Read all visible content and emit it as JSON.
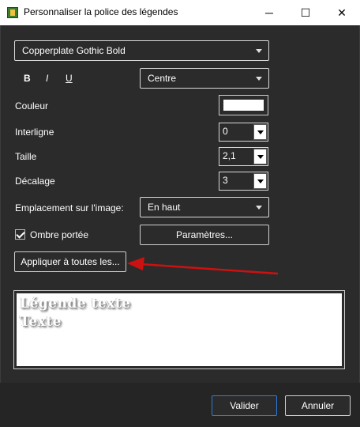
{
  "window": {
    "title": "Personnaliser la police des légendes",
    "minimize_glyph": "─",
    "maximize_glyph": "☐",
    "close_glyph": "✕"
  },
  "font": {
    "selected": "Copperplate Gothic Bold"
  },
  "format": {
    "bold": "B",
    "italic": "I",
    "underline": "U"
  },
  "alignment": {
    "selected": "Centre"
  },
  "fields": {
    "color_label": "Couleur",
    "color_value": "#ffffff",
    "line_spacing_label": "Interligne",
    "line_spacing_value": "0",
    "size_label": "Taille",
    "size_value": "2,1",
    "offset_label": "Décalage",
    "offset_value": "3",
    "placement_label": "Emplacement sur l'image:",
    "placement_value": "En haut",
    "shadow_label": "Ombre portée",
    "shadow_checked": true,
    "settings_button": "Paramètres..."
  },
  "apply_all_button": "Appliquer à toutes les...",
  "preview": {
    "line1": "Légende texte",
    "line2": "Texte"
  },
  "footer": {
    "ok": "Valider",
    "cancel": "Annuler"
  },
  "colors": {
    "accent": "#2f7bd9",
    "arrow": "#cc1111",
    "background": "#2b2b2b"
  }
}
